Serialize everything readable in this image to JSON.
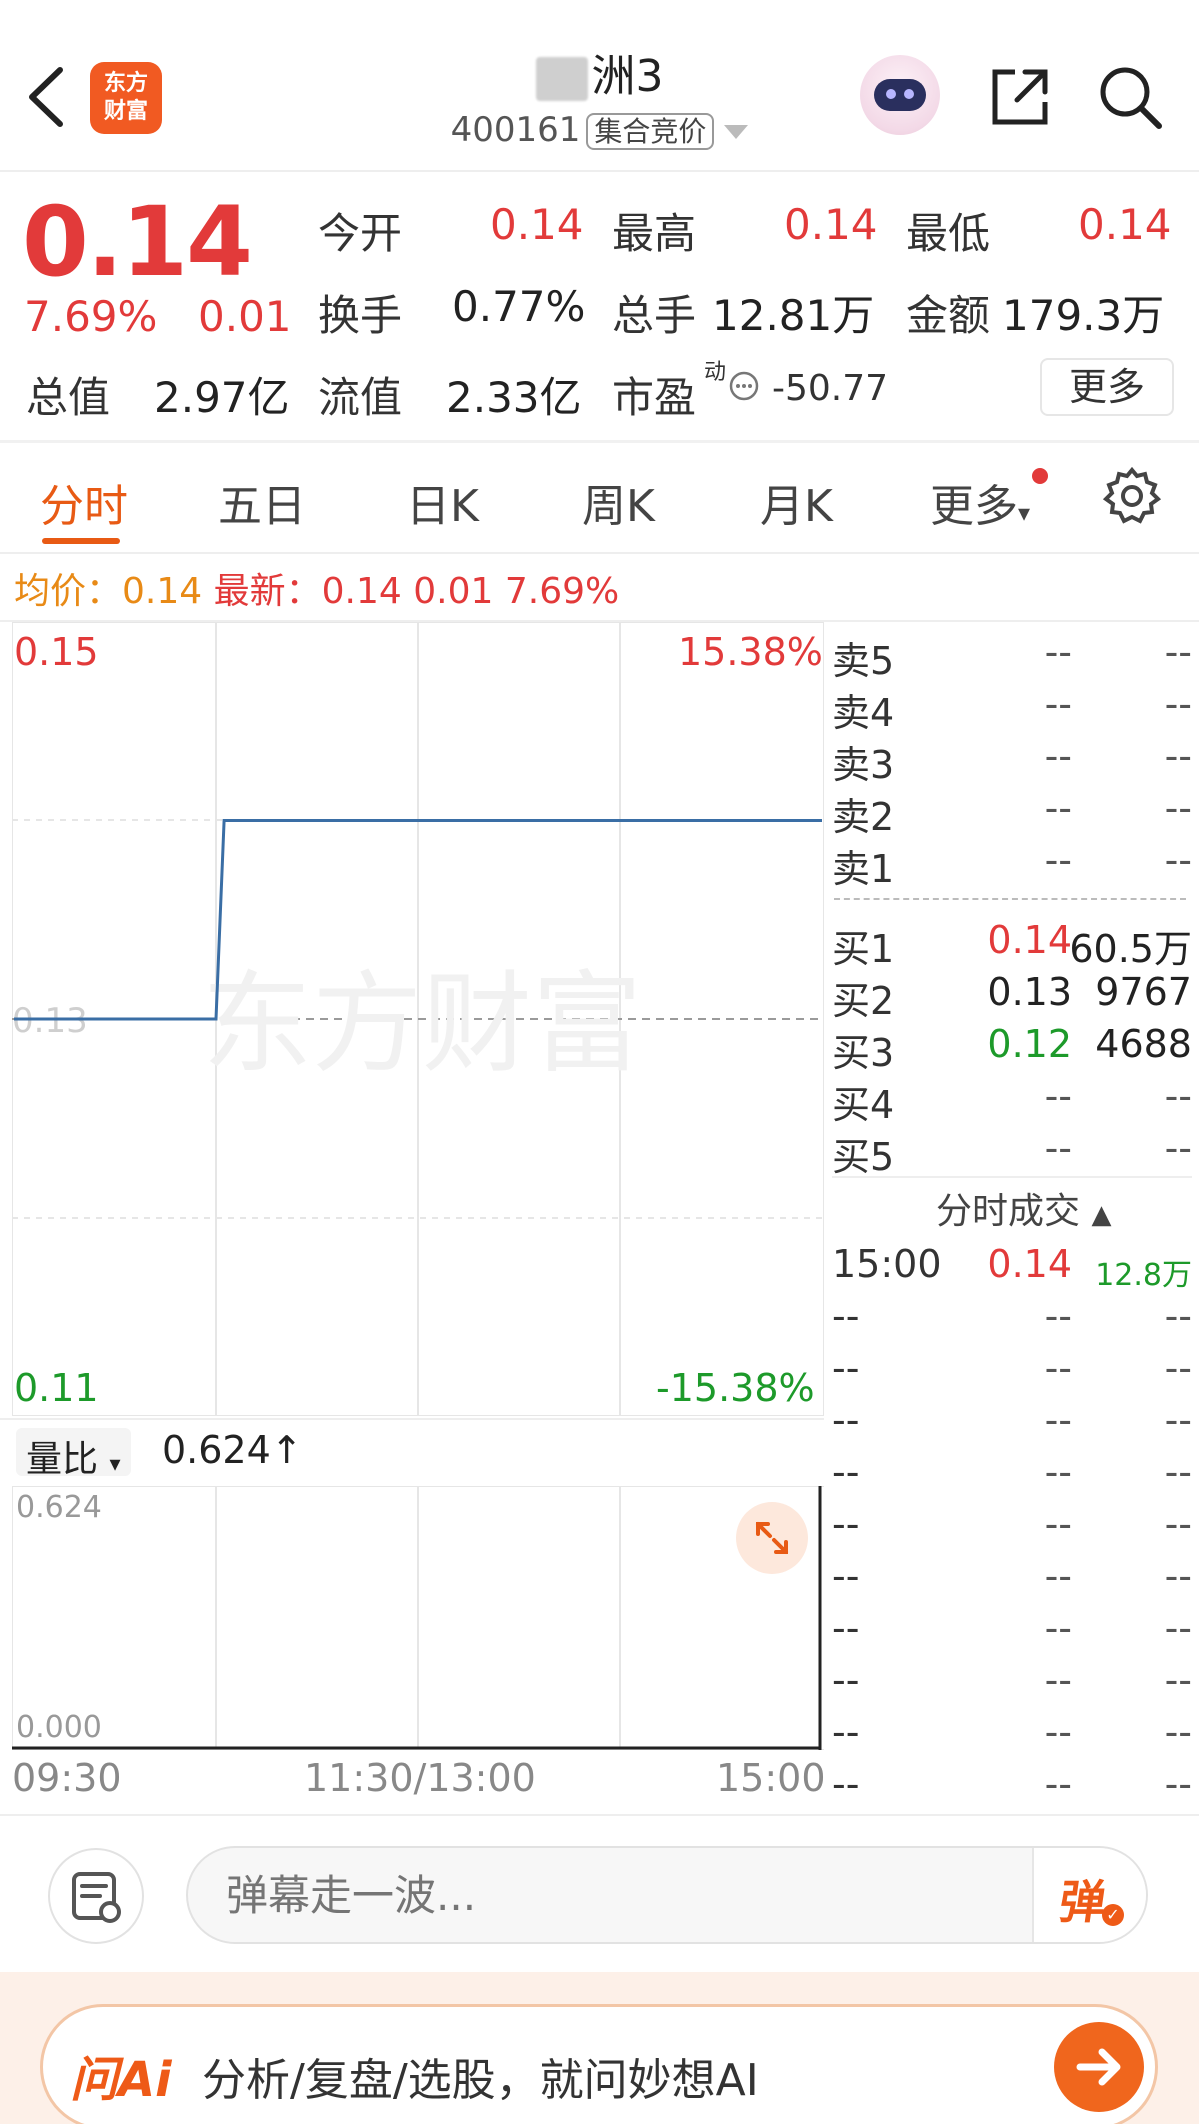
{
  "header": {
    "title": "洲3",
    "code": "400161",
    "trade_status": "集合竞价",
    "logo_text": "东方财富",
    "icons": [
      "back-icon",
      "robot-avatar-icon",
      "share-icon",
      "search-icon"
    ]
  },
  "quote": {
    "price": "0.14",
    "change_pct": "7.69%",
    "change_amt": "0.01",
    "open_label": "今开",
    "open": "0.14",
    "high_label": "最高",
    "high": "0.14",
    "low_label": "最低",
    "low": "0.14",
    "turnover_label": "换手",
    "turnover": "0.77%",
    "total_hands_label": "总手",
    "total_hands": "12.81万",
    "amount_label": "金额",
    "amount": "179.3万",
    "mktcap_label": "总值",
    "mktcap": "2.97亿",
    "float_label": "流值",
    "float_cap": "2.33亿",
    "pe_label": "市盈",
    "pe_sup": "动",
    "pe": "-50.77",
    "more_label": "更多"
  },
  "tabs": {
    "items": [
      "分时",
      "五日",
      "日K",
      "周K",
      "月K",
      "更多"
    ],
    "active": "分时"
  },
  "avg_bar": {
    "avg_label": "均价：",
    "avg": "0.14",
    "latest_label": "最新：",
    "latest": "0.14",
    "latest_chg": "0.01",
    "latest_pct": "7.69%"
  },
  "chart_data": {
    "type": "line",
    "y_top": "0.15",
    "y_top_pct": "15.38%",
    "y_bottom": "0.11",
    "y_bottom_pct": "-15.38%",
    "y_mid_hint": "0.13",
    "ylim": [
      0.11,
      0.15
    ],
    "x_ticks": [
      "09:30",
      "11:30/13:00",
      "15:00"
    ],
    "series": [
      {
        "values": [
          [
            0,
            0.13
          ],
          [
            0.25,
            0.13
          ],
          [
            0.26,
            0.14
          ],
          [
            1,
            0.14
          ]
        ]
      }
    ],
    "watermark": "东方财富"
  },
  "volume_chart": {
    "label": "量比",
    "value": "0.624↑",
    "y_top": "0.624",
    "y_bottom": "0.000"
  },
  "order_book": {
    "asks": [
      {
        "label": "卖5",
        "price": "--",
        "vol": "--"
      },
      {
        "label": "卖4",
        "price": "--",
        "vol": "--"
      },
      {
        "label": "卖3",
        "price": "--",
        "vol": "--"
      },
      {
        "label": "卖2",
        "price": "--",
        "vol": "--"
      },
      {
        "label": "卖1",
        "price": "--",
        "vol": "--"
      }
    ],
    "bids": [
      {
        "label": "买1",
        "price": "0.14",
        "vol": "60.5万",
        "color": "#e23a3a"
      },
      {
        "label": "买2",
        "price": "0.13",
        "vol": "9767",
        "color": "#222222"
      },
      {
        "label": "买3",
        "price": "0.12",
        "vol": "4688",
        "color": "#1d9a2a"
      },
      {
        "label": "买4",
        "price": "--",
        "vol": "--",
        "color": "#555555"
      },
      {
        "label": "买5",
        "price": "--",
        "vol": "--",
        "color": "#555555"
      }
    ]
  },
  "ticks": {
    "title": "分时成交",
    "rows": [
      {
        "time": "15:00",
        "price": "0.14",
        "vol": "12.8万"
      },
      {
        "time": "--",
        "price": "--",
        "vol": "--"
      },
      {
        "time": "--",
        "price": "--",
        "vol": "--"
      },
      {
        "time": "--",
        "price": "--",
        "vol": "--"
      },
      {
        "time": "--",
        "price": "--",
        "vol": "--"
      },
      {
        "time": "--",
        "price": "--",
        "vol": "--"
      },
      {
        "time": "--",
        "price": "--",
        "vol": "--"
      },
      {
        "time": "--",
        "price": "--",
        "vol": "--"
      },
      {
        "time": "--",
        "price": "--",
        "vol": "--"
      },
      {
        "time": "--",
        "price": "--",
        "vol": "--"
      },
      {
        "time": "--",
        "price": "--",
        "vol": "--"
      }
    ]
  },
  "bottom": {
    "danmu_placeholder": "弹幕走一波...",
    "danmu_button": "弹",
    "ai_logo": "问Ai",
    "ai_text": "分析/复盘/选股，就问妙想AI"
  },
  "colors": {
    "up": "#e23a3a",
    "down": "#1d9a2a",
    "accent": "#e85a14",
    "line": "#3a6ea5"
  }
}
